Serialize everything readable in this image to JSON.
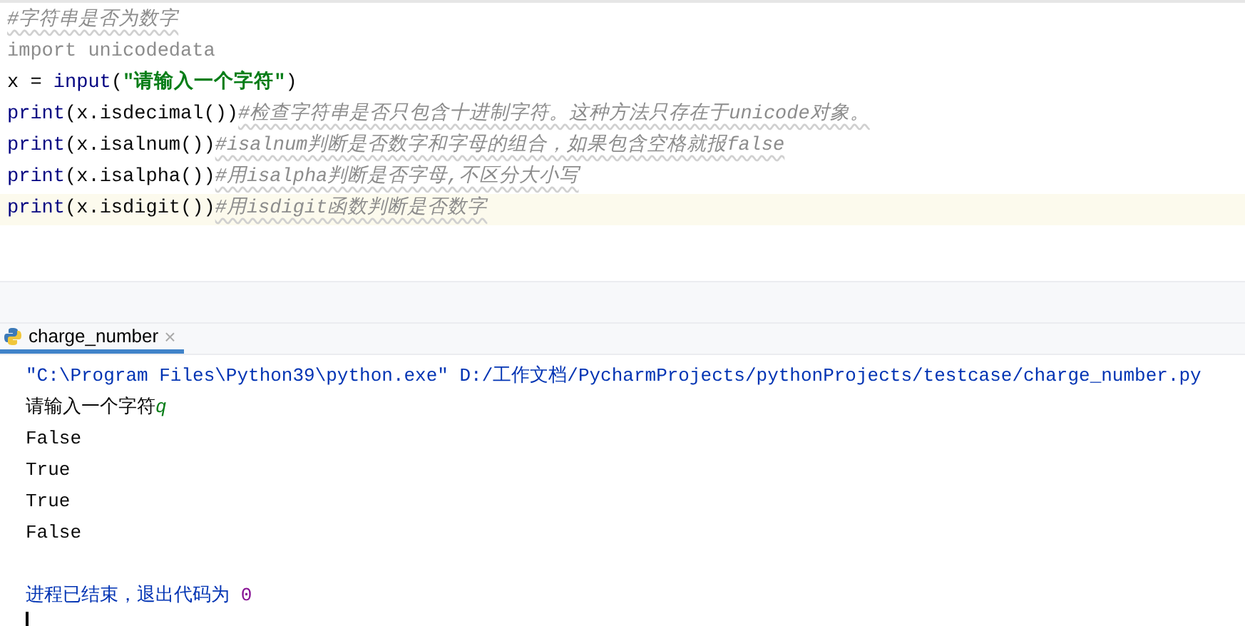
{
  "editor": {
    "lines": [
      {
        "current": false,
        "tokens": [
          {
            "kind": "comment",
            "text": "#字符串是否为数字"
          }
        ]
      },
      {
        "current": false,
        "tokens": [
          {
            "kind": "unused",
            "text": "import unicodedata"
          }
        ]
      },
      {
        "current": false,
        "tokens": [
          {
            "kind": "plain",
            "text": "x = "
          },
          {
            "kind": "builtin",
            "text": "input"
          },
          {
            "kind": "plain",
            "text": "("
          },
          {
            "kind": "string",
            "text": "\"请输入一个字符\""
          },
          {
            "kind": "plain",
            "text": ")"
          }
        ]
      },
      {
        "current": false,
        "tokens": [
          {
            "kind": "builtin",
            "text": "print"
          },
          {
            "kind": "plain",
            "text": "(x.isdecimal())"
          },
          {
            "kind": "comment",
            "text": "#检查字符串是否只包含十进制字符。这种方法只存在于unicode对象。"
          }
        ]
      },
      {
        "current": false,
        "tokens": [
          {
            "kind": "builtin",
            "text": "print"
          },
          {
            "kind": "plain",
            "text": "(x.isalnum())"
          },
          {
            "kind": "comment",
            "text": "#isalnum判断是否数字和字母的组合，如果包含空格就报false"
          }
        ]
      },
      {
        "current": false,
        "tokens": [
          {
            "kind": "builtin",
            "text": "print"
          },
          {
            "kind": "plain",
            "text": "(x.isalpha())"
          },
          {
            "kind": "comment",
            "text": "#用isalpha判断是否字母,不区分大小写"
          }
        ]
      },
      {
        "current": true,
        "tokens": [
          {
            "kind": "builtin",
            "text": "print"
          },
          {
            "kind": "plain",
            "text": "(x.isdigit())"
          },
          {
            "kind": "comment",
            "text": "#用isdigit函数判断是否数字"
          }
        ]
      }
    ]
  },
  "run_tab": {
    "label": "charge_number",
    "close": "×",
    "selected": true
  },
  "console": {
    "lines": [
      {
        "segments": [
          {
            "kind": "system",
            "text": "\"C:\\Program Files\\Python39\\python.exe\" D:/工作文档/PycharmProjects/pythonProjects/testcase/charge_number.py"
          }
        ]
      },
      {
        "segments": [
          {
            "kind": "output",
            "text": "请输入一个字符"
          },
          {
            "kind": "input",
            "text": "q"
          }
        ]
      },
      {
        "segments": [
          {
            "kind": "output",
            "text": "False"
          }
        ]
      },
      {
        "segments": [
          {
            "kind": "output",
            "text": "True"
          }
        ]
      },
      {
        "segments": [
          {
            "kind": "output",
            "text": "True"
          }
        ]
      },
      {
        "segments": [
          {
            "kind": "output",
            "text": "False"
          }
        ]
      },
      {
        "kind": "blank"
      },
      {
        "segments": [
          {
            "kind": "system",
            "text": "进程已结束，退出代码为 "
          },
          {
            "kind": "number",
            "text": "0"
          }
        ]
      }
    ]
  }
}
